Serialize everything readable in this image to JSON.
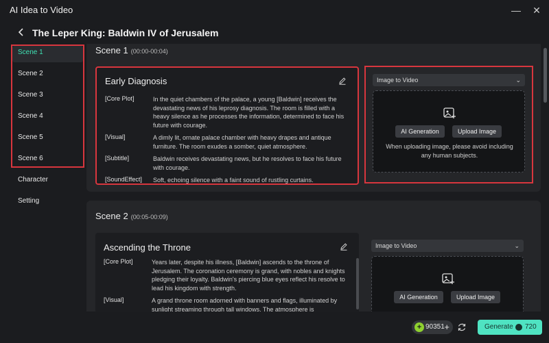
{
  "window": {
    "title": "AI Idea to Video",
    "minimize_icon": "minimize-icon",
    "close_icon": "close-icon"
  },
  "header": {
    "back_icon": "back-arrow-icon",
    "title": "The Leper King: Baldwin IV of Jerusalem"
  },
  "sidebar": {
    "items": [
      {
        "label": "Scene 1",
        "active": true
      },
      {
        "label": "Scene 2"
      },
      {
        "label": "Scene 3"
      },
      {
        "label": "Scene 4"
      },
      {
        "label": "Scene 5"
      },
      {
        "label": "Scene 6"
      },
      {
        "label": "Character"
      },
      {
        "label": "Setting"
      }
    ]
  },
  "scenes": [
    {
      "title": "Scene 1",
      "time": "(00:00-00:04)",
      "story_title": "Early Diagnosis",
      "rows": [
        {
          "label": "[Core Plot]",
          "text": "In the quiet chambers of the palace, a young [Baldwin] receives the devastating news of his leprosy diagnosis. The room is filled with a heavy silence as he processes the information, determined to face his future with courage."
        },
        {
          "label": "[Visual]",
          "text": "A dimly lit, ornate palace chamber with heavy drapes and antique furniture. The room exudes a somber, quiet atmosphere."
        },
        {
          "label": "[Subtitle]",
          "text": "Baldwin receives devastating news, but he resolves to face his future with courage."
        },
        {
          "label": "[SoundEffect]",
          "text": "Soft, echoing silence with a faint sound of rustling curtains."
        }
      ],
      "media_mode": "Image to Video",
      "ai_button": "AI Generation",
      "upload_button": "Upload Image",
      "hint": "When uploading image, please avoid including any human subjects."
    },
    {
      "title": "Scene 2",
      "time": "(00:05-00:09)",
      "story_title": "Ascending the Throne",
      "rows": [
        {
          "label": "[Core Plot]",
          "text": "Years later, despite his illness, [Baldwin] ascends to the throne of Jerusalem. The coronation ceremony is grand, with nobles and knights pledging their loyalty. Baldwin's piercing blue eyes reflect his resolve to lead his kingdom with strength."
        },
        {
          "label": "[Visual]",
          "text": "A grand throne room adorned with banners and flags, illuminated by sunlight streaming through tall windows. The atmosphere is"
        }
      ],
      "media_mode": "Image to Video",
      "ai_button": "AI Generation",
      "upload_button": "Upload Image"
    }
  ],
  "footer": {
    "credits": "90351",
    "generate_label": "Generate",
    "generate_cost": "720"
  },
  "colors": {
    "accent": "#4fe3c2",
    "active_text": "#3fe3b5",
    "highlight_border": "#d9363e",
    "background": "#1b1c1f",
    "card": "#252629"
  }
}
